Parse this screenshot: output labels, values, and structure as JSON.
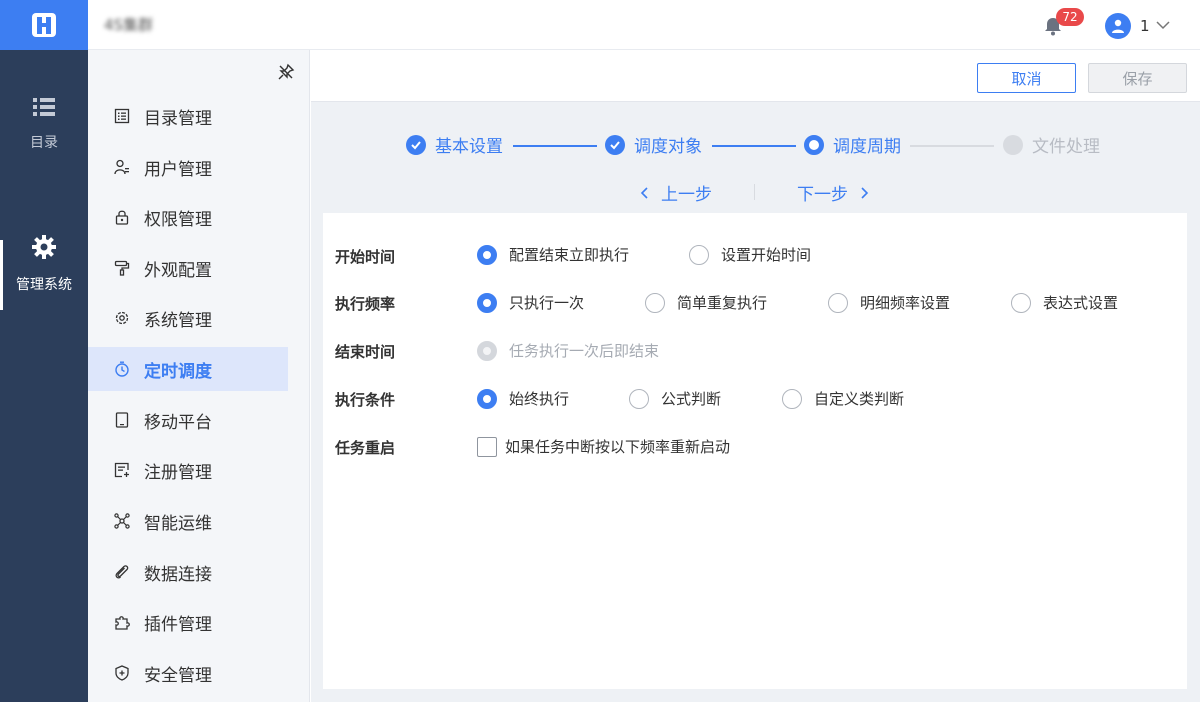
{
  "header": {
    "app_title": "4S集群",
    "notification_count": "72",
    "user_name": "1"
  },
  "rail": {
    "items": [
      {
        "label": "目录",
        "icon": "list-icon"
      },
      {
        "label": "管理系统",
        "icon": "gear-icon",
        "active": true
      }
    ]
  },
  "sidebar": {
    "items": [
      {
        "label": "目录管理",
        "icon": "catalog-icon"
      },
      {
        "label": "用户管理",
        "icon": "user-list-icon"
      },
      {
        "label": "权限管理",
        "icon": "lock-icon"
      },
      {
        "label": "外观配置",
        "icon": "paint-roller-icon"
      },
      {
        "label": "系统管理",
        "icon": "settings-icon"
      },
      {
        "label": "定时调度",
        "icon": "timer-icon",
        "active": true
      },
      {
        "label": "移动平台",
        "icon": "tablet-icon"
      },
      {
        "label": "注册管理",
        "icon": "register-icon"
      },
      {
        "label": "智能运维",
        "icon": "network-icon"
      },
      {
        "label": "数据连接",
        "icon": "paperclip-icon"
      },
      {
        "label": "插件管理",
        "icon": "puzzle-icon"
      },
      {
        "label": "安全管理",
        "icon": "shield-icon"
      }
    ]
  },
  "actions": {
    "cancel_label": "取消",
    "save_label": "保存"
  },
  "steps": [
    {
      "label": "基本设置",
      "status": "done"
    },
    {
      "label": "调度对象",
      "status": "done"
    },
    {
      "label": "调度周期",
      "status": "current"
    },
    {
      "label": "文件处理",
      "status": "pending"
    }
  ],
  "nav": {
    "prev_label": "上一步",
    "next_label": "下一步"
  },
  "form": {
    "start_time": {
      "label": "开始时间",
      "options": [
        "配置结束立即执行",
        "设置开始时间"
      ],
      "selected": 0
    },
    "frequency": {
      "label": "执行频率",
      "options": [
        "只执行一次",
        "简单重复执行",
        "明细频率设置",
        "表达式设置"
      ],
      "selected": 0
    },
    "end_time": {
      "label": "结束时间",
      "options": [
        "任务执行一次后即结束"
      ],
      "selected": 0
    },
    "condition": {
      "label": "执行条件",
      "options": [
        "始终执行",
        "公式判断",
        "自定义类判断"
      ],
      "selected": 0
    },
    "restart": {
      "label": "任务重启",
      "checkbox_label": "如果任务中断按以下频率重新启动",
      "checked": false
    }
  },
  "colors": {
    "accent": "#3d7ef2",
    "rail_bg": "#2c3e5b",
    "badge": "#e9494a"
  }
}
